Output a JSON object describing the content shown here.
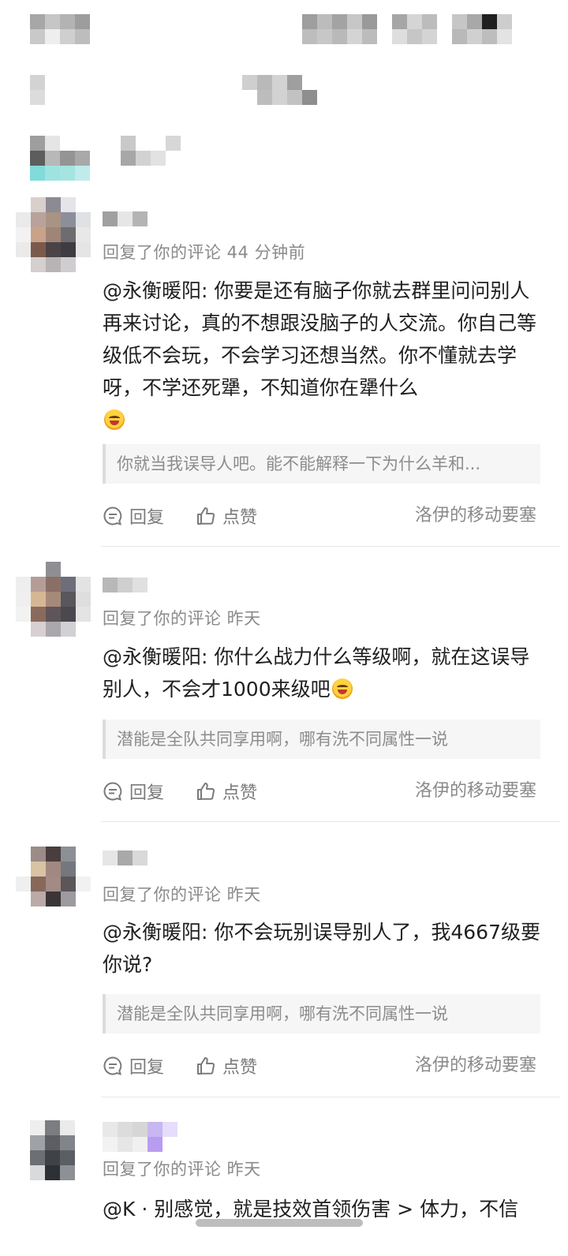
{
  "comments": [
    {
      "meta": "回复了你的评论 44 分钟前",
      "body": "@永衡暖阳: 你要是还有脑子你就去群里问问别人再来讨论，真的不想跟没脑子的人交流。你自己等级低不会玩，不会学习还想当然。你不懂就去学呀，不学还死犟，不知道你在犟什么",
      "quote": "你就当我误导人吧。能不能解释一下为什么羊和...",
      "reply_label": "回复",
      "like_label": "点赞",
      "source": "洛伊的移动要塞"
    },
    {
      "meta": "回复了你的评论 昨天",
      "body": "@永衡暖阳: 你什么战力什么等级啊，就在这误导别人，不会才1000来级吧",
      "quote": "潜能是全队共同享用啊，哪有洗不同属性一说",
      "reply_label": "回复",
      "like_label": "点赞",
      "source": "洛伊的移动要塞"
    },
    {
      "meta": "回复了你的评论 昨天",
      "body": "@永衡暖阳: 你不会玩别误导别人了，我4667级要你说?",
      "quote": "潜能是全队共同享用啊，哪有洗不同属性一说",
      "reply_label": "回复",
      "like_label": "点赞",
      "source": "洛伊的移动要塞"
    },
    {
      "meta": "回复了你的评论 昨天",
      "body": "@K · 别感觉，就是技效首领伤害 > 体力，不信"
    }
  ],
  "icons": {
    "reply": "comment-bubble-icon",
    "like": "thumbs-up-icon"
  },
  "colors": {
    "text": "#1f1f1f",
    "meta": "#8a8a8a",
    "quote_bg": "#f6f6f7",
    "divider": "#e8e8e8"
  }
}
